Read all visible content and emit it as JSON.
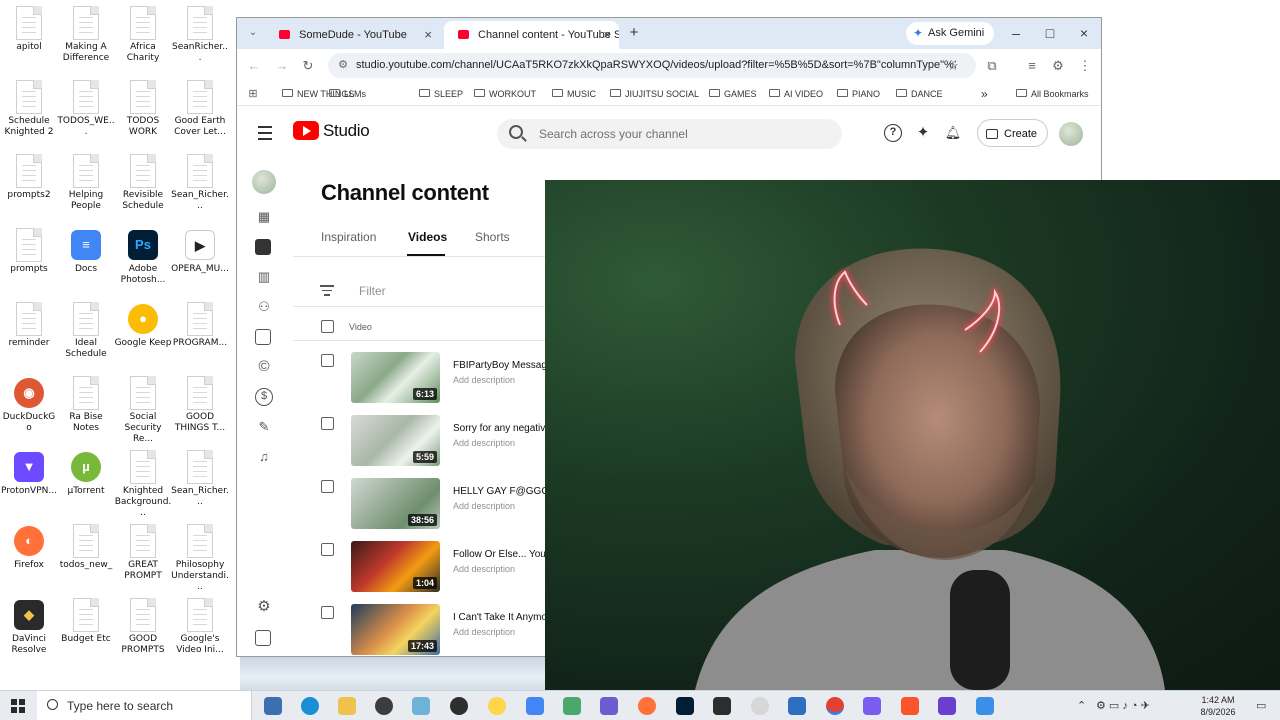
{
  "desktop": {
    "icons": [
      {
        "label": "apitol",
        "type": "doc"
      },
      {
        "label": "Making A\nDifference",
        "type": "doc"
      },
      {
        "label": "Africa Charity",
        "type": "doc"
      },
      {
        "label": "SeanRicher...",
        "type": "doc"
      },
      {
        "label": "Schedule\nKnighted 2",
        "type": "doc"
      },
      {
        "label": "TODOS_WE...",
        "type": "doc"
      },
      {
        "label": "TODOS\nWORK",
        "type": "doc"
      },
      {
        "label": "Good Earth\nCover Let...",
        "type": "doc"
      },
      {
        "label": "prompts2",
        "type": "doc"
      },
      {
        "label": "Helping\nPeople",
        "type": "doc"
      },
      {
        "label": "Revisible\nSchedule",
        "type": "doc"
      },
      {
        "label": "Sean_Richer...",
        "type": "doc"
      },
      {
        "label": "prompts",
        "type": "doc"
      },
      {
        "label": "Docs",
        "type": "docs"
      },
      {
        "label": "Adobe\nPhotosh...",
        "type": "ps"
      },
      {
        "label": "OPERA_MU...",
        "type": "opera"
      },
      {
        "label": "reminder",
        "type": "doc"
      },
      {
        "label": "Ideal\nSchedule",
        "type": "doc"
      },
      {
        "label": "Google Keep",
        "type": "keep"
      },
      {
        "label": "PROGRAM...",
        "type": "doc"
      },
      {
        "label": "DuckDuckGo",
        "type": "ddg"
      },
      {
        "label": "Ra Bise Notes",
        "type": "doc"
      },
      {
        "label": "Social\nSecurity Re...",
        "type": "doc"
      },
      {
        "label": "GOOD\nTHINGS T...",
        "type": "doc"
      },
      {
        "label": "ProtonVPN...",
        "type": "vpn"
      },
      {
        "label": "µTorrent",
        "type": "utorrent"
      },
      {
        "label": "Knighted\nBackground...",
        "type": "doc"
      },
      {
        "label": "Sean_Richer...",
        "type": "doc"
      },
      {
        "label": "Firefox",
        "type": "firefox"
      },
      {
        "label": "todos_new_",
        "type": "doc"
      },
      {
        "label": "GREAT\nPROMPT",
        "type": "doc"
      },
      {
        "label": "Philosophy\nUnderstandi...",
        "type": "doc"
      },
      {
        "label": "DaVinci\nResolve",
        "type": "davinci"
      },
      {
        "label": "Budget Etc",
        "type": "doc"
      },
      {
        "label": "GOOD\nPROMPTS",
        "type": "doc"
      },
      {
        "label": "Google's\nVideo Ini...",
        "type": "doc"
      }
    ]
  },
  "browser": {
    "tabs": [
      {
        "title": "SomeDude - YouTube",
        "close": "×"
      },
      {
        "title": "Channel content - YouTube Stu",
        "close": "×"
      }
    ],
    "new_tab": "+",
    "ask_gemini": "Ask Gemini",
    "window_controls": {
      "minimize": "–",
      "maximize": "□",
      "close": "×"
    },
    "url": "studio.youtube.com/channel/UCAaT5RKO7zkXkQpaRSWYXOQ/videos/upload?filter=%5B%5D&sort=%7B\"columnType\"%3A...",
    "bookmarks": [
      "NEW THINGS",
      "LLMs",
      "SLEEP",
      "WORKOUT",
      "MUSIC",
      "JIUJITSU SOCIAL",
      "GAMES",
      "AI VIDEO",
      "PIANO",
      "DANCE"
    ],
    "bookmarks_overflow": "»",
    "all_bookmarks": "All Bookmarks"
  },
  "studio": {
    "logo_text": "Studio",
    "search_placeholder": "Search across your channel",
    "create_label": "Create",
    "page_title": "Channel content",
    "tabs": [
      "Inspiration",
      "Videos",
      "Shorts"
    ],
    "active_tab": "Videos",
    "filter_placeholder": "Filter",
    "column_video": "Video",
    "videos": [
      {
        "title": "FBIPartyBoy Message",
        "description": "Add description",
        "duration": "6:13"
      },
      {
        "title": "Sorry for any negativity",
        "description": "Add description",
        "duration": "5:59"
      },
      {
        "title": "HELLY GAY F@GGOT",
        "description": "Add description",
        "duration": "38:56"
      },
      {
        "title": "Follow Or Else... You",
        "description": "Add description",
        "duration": "1:04"
      },
      {
        "title": "I Can't Take It Anymore",
        "description": "Add description",
        "duration": "17:43"
      }
    ]
  },
  "taskbar": {
    "search_text": "Type here to search",
    "time": "1:42 AM",
    "date": "8/9/2026"
  },
  "colors": {
    "youtube_red": "#ff0000",
    "tabstrip": "#dfe8f5",
    "taskbar": "#e8ebf0",
    "accent_blue": "#3b7be8"
  }
}
